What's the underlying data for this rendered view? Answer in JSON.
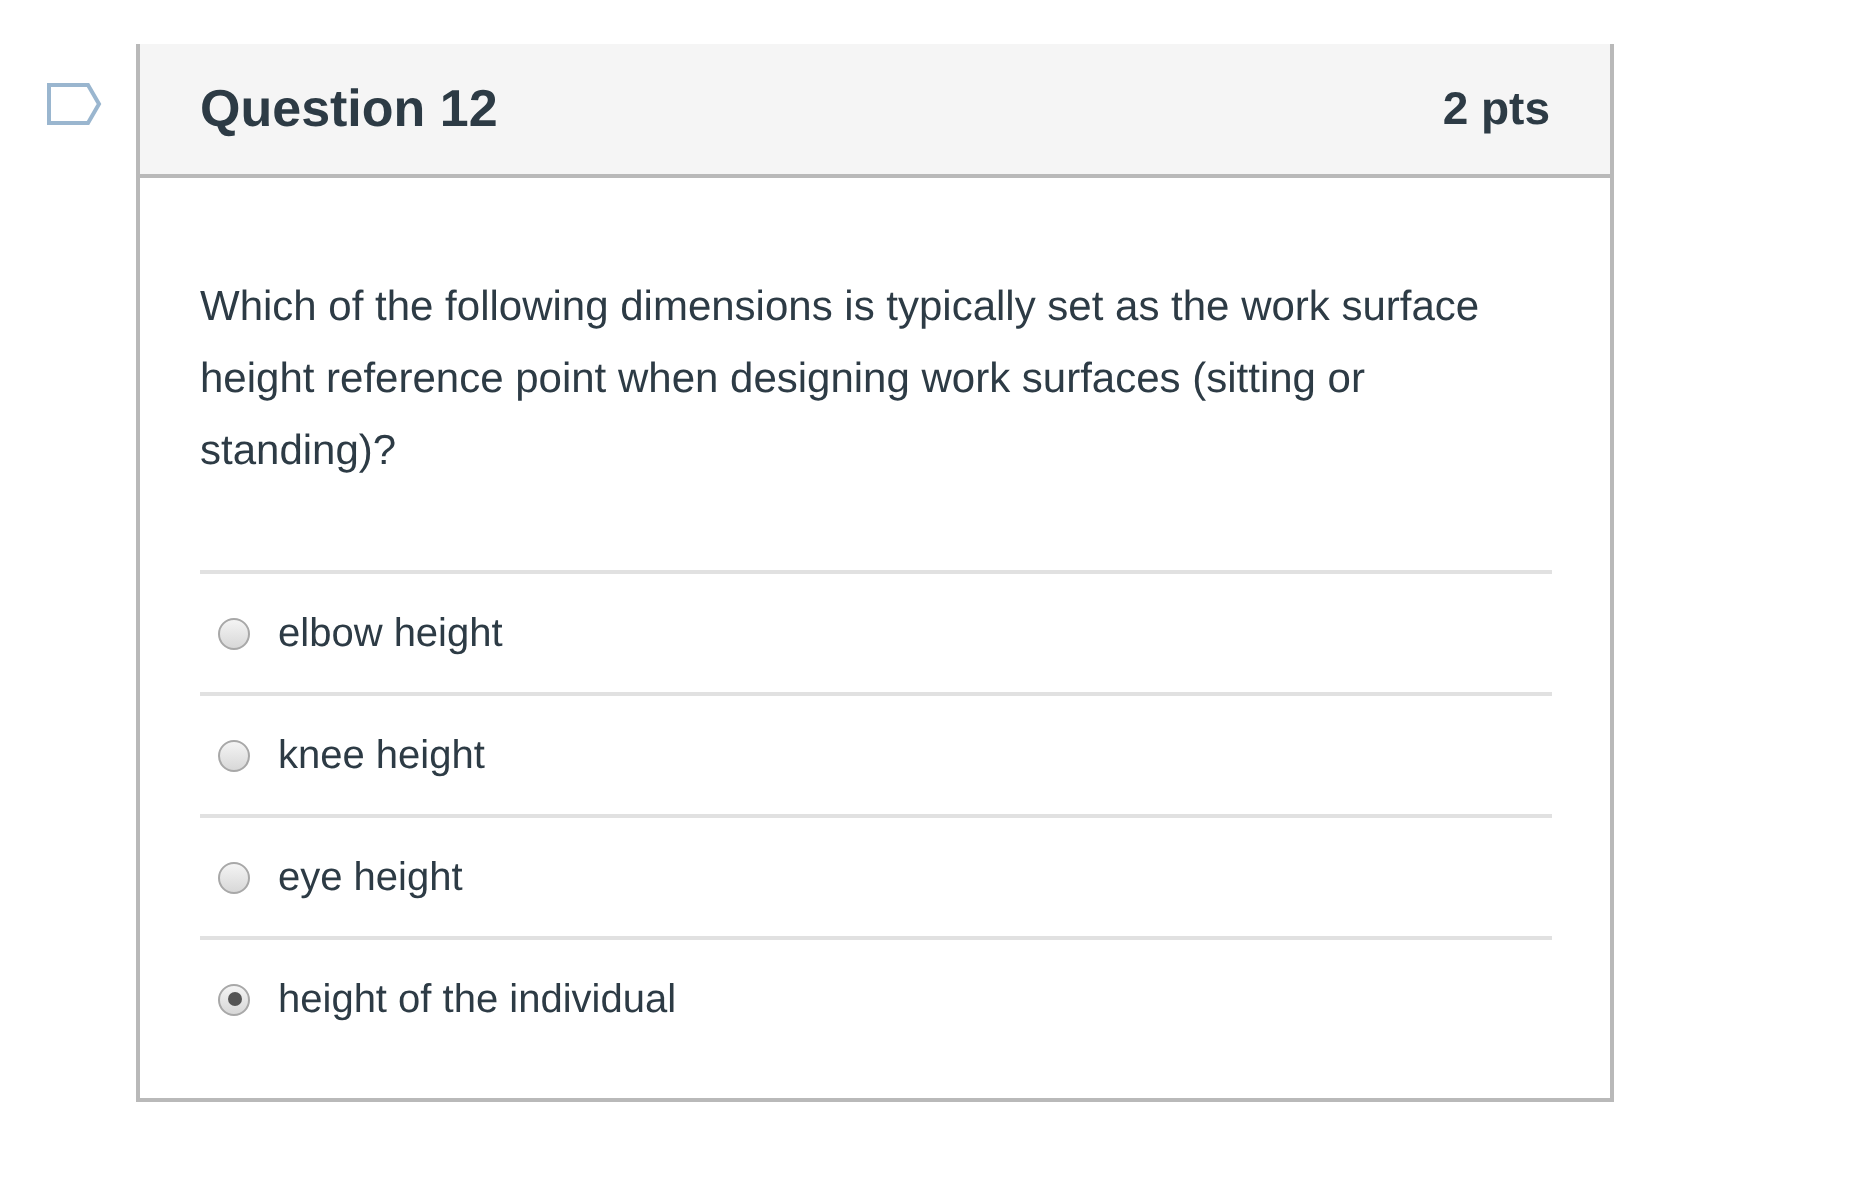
{
  "question": {
    "title": "Question 12",
    "points": "2 pts",
    "flagged": false,
    "text": "Which of the following dimensions is typically set as the work surface height reference point when designing work surfaces (sitting or standing)?",
    "answers": [
      {
        "label": "elbow height",
        "selected": false
      },
      {
        "label": "knee height",
        "selected": false
      },
      {
        "label": "eye height",
        "selected": false
      },
      {
        "label": "height of the individual",
        "selected": true
      }
    ]
  }
}
